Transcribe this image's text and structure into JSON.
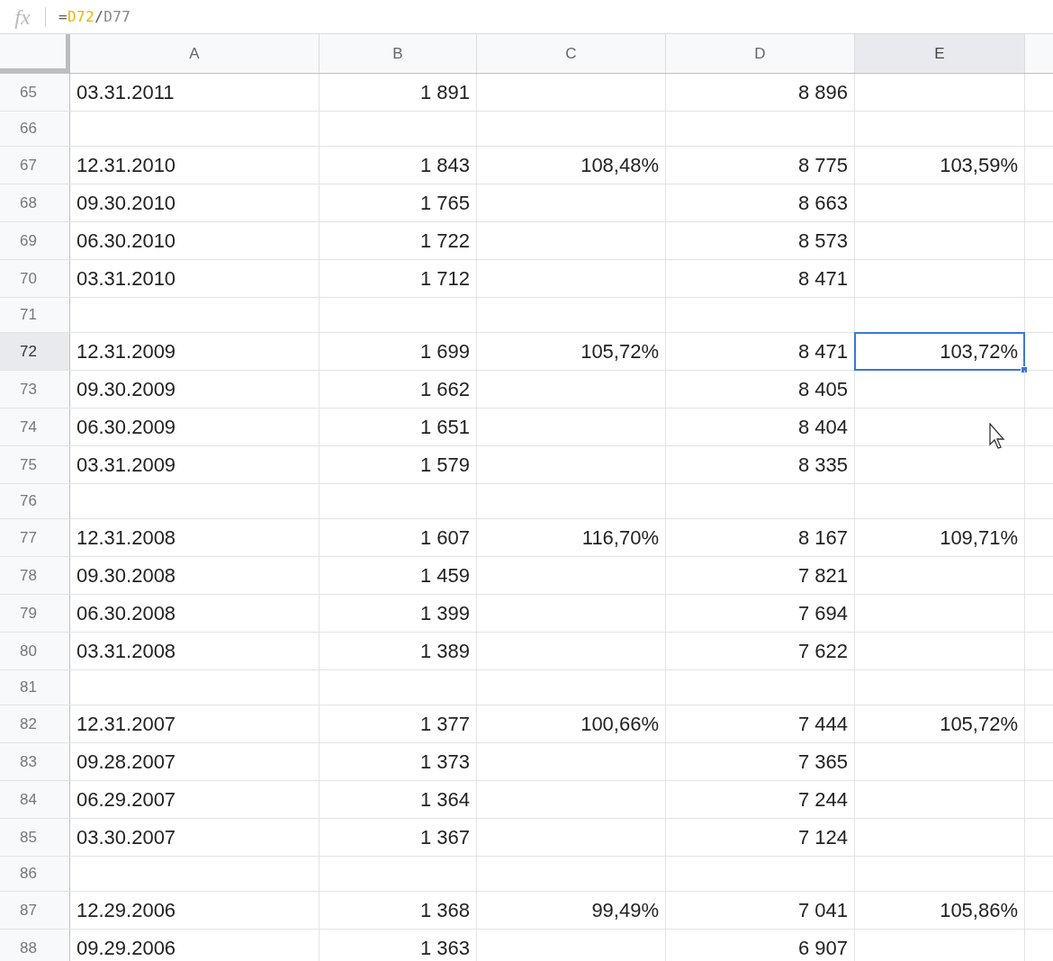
{
  "formula_bar": {
    "label": "fx",
    "tokens": [
      {
        "text": "=",
        "kind": "op"
      },
      {
        "text": "D72",
        "kind": "ref",
        "color": "#f0b400"
      },
      {
        "text": "/",
        "kind": "op"
      },
      {
        "text": "D77",
        "kind": "ref",
        "color": "#8e8294"
      }
    ]
  },
  "columns": [
    {
      "label": "A",
      "selected": false
    },
    {
      "label": "B",
      "selected": false
    },
    {
      "label": "C",
      "selected": false
    },
    {
      "label": "D",
      "selected": false
    },
    {
      "label": "E",
      "selected": true
    }
  ],
  "rows": [
    {
      "number": "65",
      "selected": false,
      "cells": [
        "03.31.2011",
        "1 891",
        null,
        "8 896",
        null
      ]
    },
    {
      "number": "66",
      "selected": false
    },
    {
      "number": "67",
      "selected": false,
      "cells": [
        "12.31.2010",
        "1 843",
        "108,48%",
        "8 775",
        "103,59%"
      ]
    },
    {
      "number": "68",
      "selected": false,
      "cells": [
        "09.30.2010",
        "1 765",
        null,
        "8 663",
        null
      ]
    },
    {
      "number": "69",
      "selected": false,
      "cells": [
        "06.30.2010",
        "1 722",
        null,
        "8 573",
        null
      ]
    },
    {
      "number": "70",
      "selected": false,
      "cells": [
        "03.31.2010",
        "1 712",
        null,
        "8 471",
        null
      ]
    },
    {
      "number": "71",
      "selected": false
    },
    {
      "number": "72",
      "selected": true,
      "cells": [
        "12.31.2009",
        "1 699",
        "105,72%",
        "8 471",
        "103,72%"
      ]
    },
    {
      "number": "73",
      "selected": false,
      "cells": [
        "09.30.2009",
        "1 662",
        null,
        "8 405",
        null
      ]
    },
    {
      "number": "74",
      "selected": false,
      "cells": [
        "06.30.2009",
        "1 651",
        null,
        "8 404",
        null
      ]
    },
    {
      "number": "75",
      "selected": false,
      "cells": [
        "03.31.2009",
        "1 579",
        null,
        "8 335",
        null
      ]
    },
    {
      "number": "76",
      "selected": false
    },
    {
      "number": "77",
      "selected": false,
      "cells": [
        "12.31.2008",
        "1 607",
        "116,70%",
        "8 167",
        "109,71%"
      ]
    },
    {
      "number": "78",
      "selected": false,
      "cells": [
        "09.30.2008",
        "1 459",
        null,
        "7 821",
        null
      ]
    },
    {
      "number": "79",
      "selected": false,
      "cells": [
        "06.30.2008",
        "1 399",
        null,
        "7 694",
        null
      ]
    },
    {
      "number": "80",
      "selected": false,
      "cells": [
        "03.31.2008",
        "1 389",
        null,
        "7 622",
        null
      ]
    },
    {
      "number": "81",
      "selected": false
    },
    {
      "number": "82",
      "selected": false,
      "cells": [
        "12.31.2007",
        "1 377",
        "100,66%",
        "7 444",
        "105,72%"
      ]
    },
    {
      "number": "83",
      "selected": false,
      "cells": [
        "09.28.2007",
        "1 373",
        null,
        "7 365",
        null
      ]
    },
    {
      "number": "84",
      "selected": false,
      "cells": [
        "06.29.2007",
        "1 364",
        null,
        "7 244",
        null
      ]
    },
    {
      "number": "85",
      "selected": false,
      "cells": [
        "03.30.2007",
        "1 367",
        null,
        "7 124",
        null
      ]
    },
    {
      "number": "86",
      "selected": false
    },
    {
      "number": "87",
      "selected": false,
      "cells": [
        "12.29.2006",
        "1 368",
        "99,49%",
        "7 041",
        "105,86%"
      ]
    },
    {
      "number": "88",
      "selected": false,
      "cells": [
        "09.29.2006",
        "1 363",
        null,
        "6 907",
        null
      ]
    }
  ]
}
